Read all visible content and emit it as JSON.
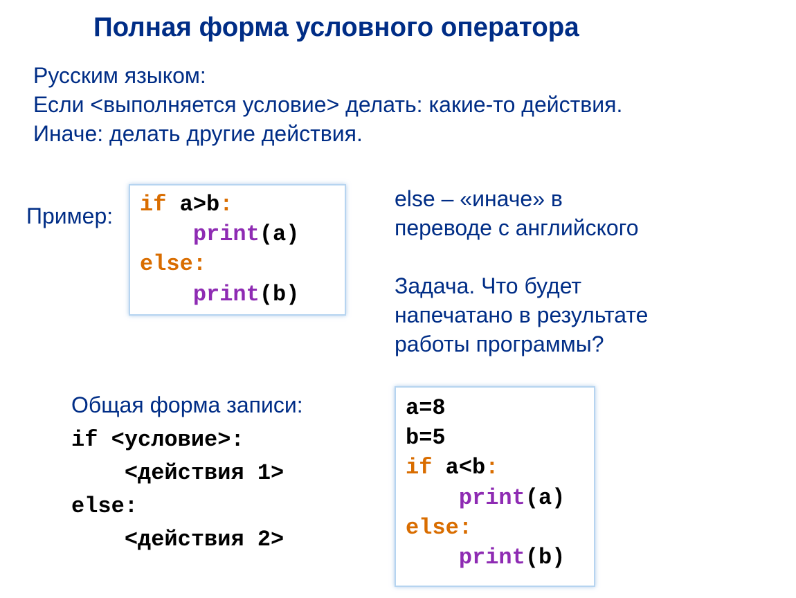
{
  "title": "Полная форма условного оператора",
  "intro_line1": "Русским языком:",
  "intro_line2": "Если <выполняется условие> делать: какие-то действия.",
  "intro_line3": "Иначе: делать другие действия.",
  "example_label": "Пример:",
  "note_else_line1": "else – «иначе» в",
  "note_else_line2": "переводе с английского",
  "task_line1": "Задача. Что будет",
  "task_line2": "напечатано в результате",
  "task_line3": "работы программы?",
  "form_label": "Общая форма записи:",
  "form_code_line1": "if <условие>:",
  "form_code_line2": "    <действия 1>",
  "form_code_line3": "else:",
  "form_code_line4": "    <действия 2>",
  "code1": {
    "kw_if": "if",
    "cond1": " a>b",
    "colon": ":",
    "indent": "    ",
    "fn_print": "print",
    "arg_a": "(a)",
    "kw_else": "else",
    "arg_b": "(b)"
  },
  "code2": {
    "l1": "a=8",
    "l2": "b=5",
    "kw_if": "if",
    "cond": " a<b",
    "colon": ":",
    "indent": "    ",
    "fn_print": "print",
    "arg_a": "(a)",
    "kw_else": "else",
    "arg_b": "(b)"
  }
}
